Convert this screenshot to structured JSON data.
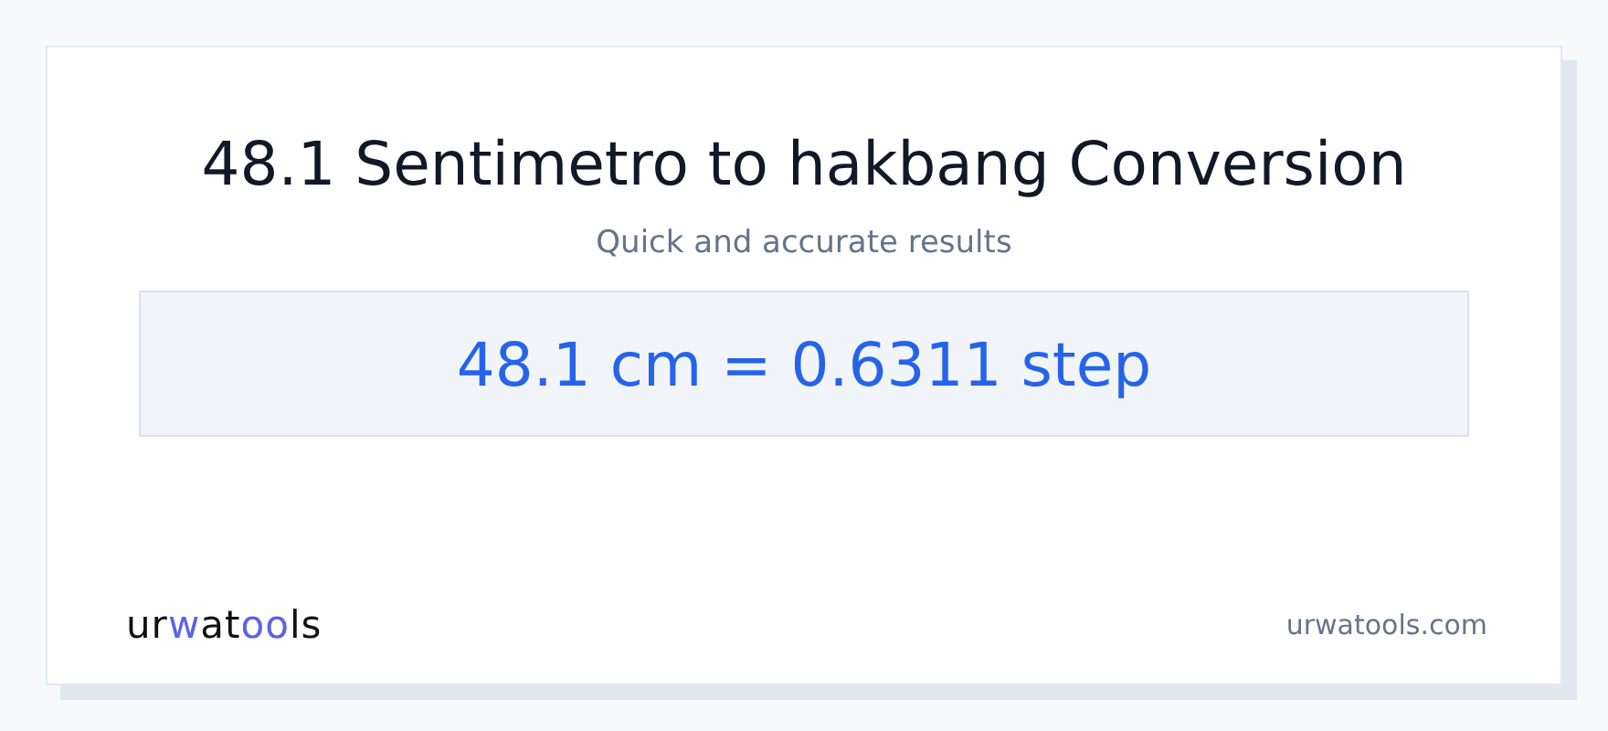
{
  "title": "48.1 Sentimetro to hakbang Conversion",
  "subtitle": "Quick and accurate results",
  "result": "48.1 cm = 0.6311 step",
  "logo": [
    {
      "text": "ur",
      "accent": false
    },
    {
      "text": "w",
      "accent": true
    },
    {
      "text": "at",
      "accent": false
    },
    {
      "text": "oo",
      "accent": true
    },
    {
      "text": "ls",
      "accent": false
    }
  ],
  "site": "urwatools.com"
}
